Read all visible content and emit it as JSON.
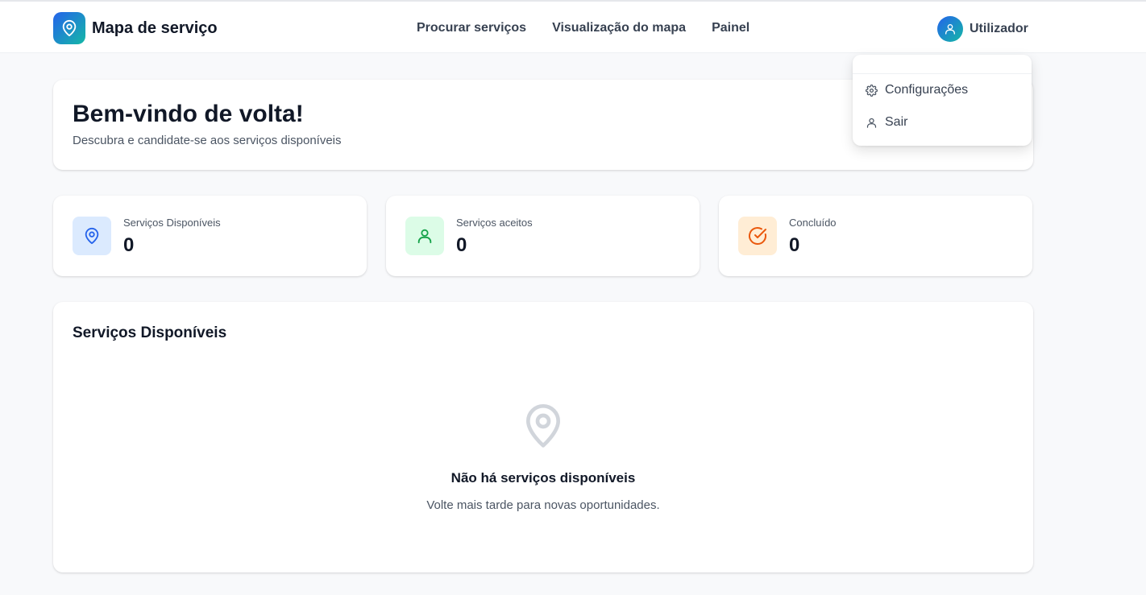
{
  "header": {
    "brand": "Mapa de serviço",
    "nav": [
      "Procurar serviços",
      "Visualização do mapa",
      "Painel"
    ],
    "user": "Utilizador"
  },
  "dropdown": {
    "settings": "Configurações",
    "logout": "Sair"
  },
  "welcome": {
    "title": "Bem-vindo de volta!",
    "subtitle": "Descubra e candidate-se aos serviços disponíveis"
  },
  "stats": [
    {
      "label": "Serviços Disponíveis",
      "value": "0",
      "icon": "map-pin-icon",
      "color": "#2563eb",
      "bg": "#dbeafe"
    },
    {
      "label": "Serviços aceitos",
      "value": "0",
      "icon": "user-icon",
      "color": "#16a34a",
      "bg": "#dcfce7"
    },
    {
      "label": "Concluído",
      "value": "0",
      "icon": "check-circle-icon",
      "color": "#ea580c",
      "bg": "#ffedd5"
    }
  ],
  "services": {
    "title": "Serviços Disponíveis",
    "empty_title": "Não há serviços disponíveis",
    "empty_subtitle": "Volte mais tarde para novas oportunidades."
  }
}
